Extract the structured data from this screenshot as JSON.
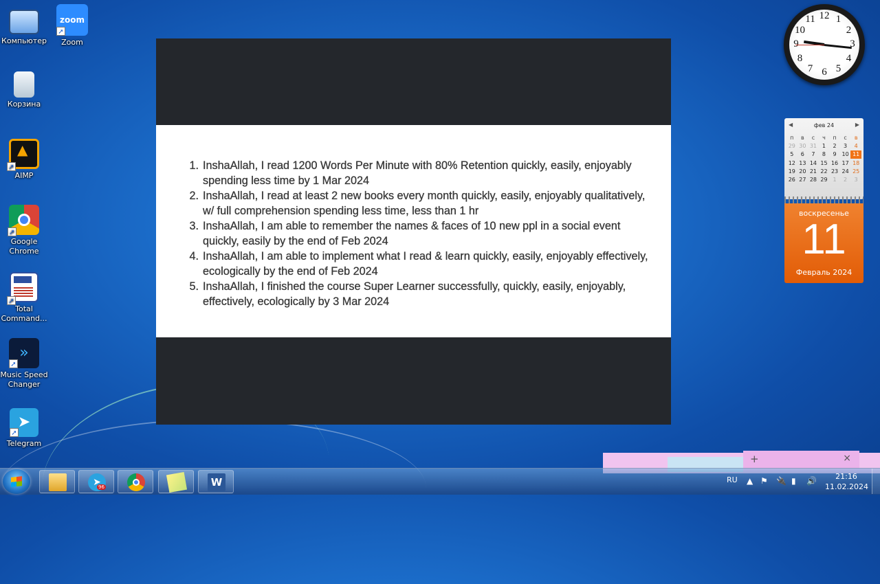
{
  "desktop": {
    "icons": [
      {
        "label": "Компьютер",
        "icon": "computer-icon"
      },
      {
        "label": "Zoom",
        "icon": "zoom-icon",
        "glyph": "zoom"
      },
      {
        "label": "Корзина",
        "icon": "recycle-bin-icon"
      },
      {
        "label": "AIMP",
        "icon": "aimp-icon"
      },
      {
        "label": "Google Chrome",
        "icon": "chrome-icon"
      },
      {
        "label": "Total Command...",
        "icon": "total-commander-icon"
      },
      {
        "label": "Music Speed Changer",
        "icon": "music-speed-changer-icon"
      },
      {
        "label": "Telegram",
        "icon": "telegram-icon"
      }
    ]
  },
  "viewer": {
    "goals": [
      {
        "num": "1.",
        "text": "InshaAllah, I read 1200 Words Per Minute with 80% Retention quickly, easily, enjoyably spending less time by 1 Mar 2024"
      },
      {
        "num": "2.",
        "text": "InshaAllah, I read at least 2 new books every month quickly, easily, enjoyably qualitatively, w/ full comprehension spending less time, less than 1 hr"
      },
      {
        "num": "3.",
        "text": "InshaAllah, I am able to remember the names & faces of 10 new ppl in a social event quickly, easily by the end of Feb 2024"
      },
      {
        "num": "4.",
        "text": "InshaAllah, I am able to implement what I read & learn quickly, easily, enjoyably effectively, ecologically by the end of Feb 2024"
      },
      {
        "num": "5.",
        "text": "InshaAllah, I finished the course Super Learner successfully, quickly, easily, enjoyably, effectively, ecologically by 3 Mar 2024"
      }
    ]
  },
  "clock": {
    "numbers": [
      "12",
      "1",
      "2",
      "3",
      "4",
      "5",
      "6",
      "7",
      "8",
      "9",
      "10",
      "11"
    ],
    "hour": 21,
    "minute": 16
  },
  "calendar": {
    "month_label": "фев 24",
    "weekdays": [
      "п",
      "в",
      "с",
      "ч",
      "п",
      "с",
      "в"
    ],
    "weeks": [
      [
        "29",
        "30",
        "31",
        "1",
        "2",
        "3",
        "4"
      ],
      [
        "5",
        "6",
        "7",
        "8",
        "9",
        "10",
        "11"
      ],
      [
        "12",
        "13",
        "14",
        "15",
        "16",
        "17",
        "18"
      ],
      [
        "19",
        "20",
        "21",
        "22",
        "23",
        "24",
        "25"
      ],
      [
        "26",
        "27",
        "28",
        "29",
        "1",
        "2",
        "3"
      ]
    ],
    "today": "11",
    "weekday_full": "воскресенье",
    "day_number": "11",
    "month_year": "Февраль 2024",
    "accent": "#f07318"
  },
  "sticky_note": {
    "add": "+",
    "close": "×"
  },
  "taskbar": {
    "pinned": [
      {
        "name": "explorer-taskbar-button",
        "icon": "folder-icon"
      },
      {
        "name": "telegram-taskbar-button",
        "icon": "telegram-icon",
        "badge": "96"
      },
      {
        "name": "chrome-taskbar-button",
        "icon": "chrome-icon"
      },
      {
        "name": "sticky-notes-taskbar-button",
        "icon": "sticky-notes-icon"
      },
      {
        "name": "word-taskbar-button",
        "icon": "word-icon",
        "glyph": "W"
      }
    ],
    "tray": {
      "language": "RU",
      "time": "21:16",
      "date": "11.02.2024"
    }
  }
}
